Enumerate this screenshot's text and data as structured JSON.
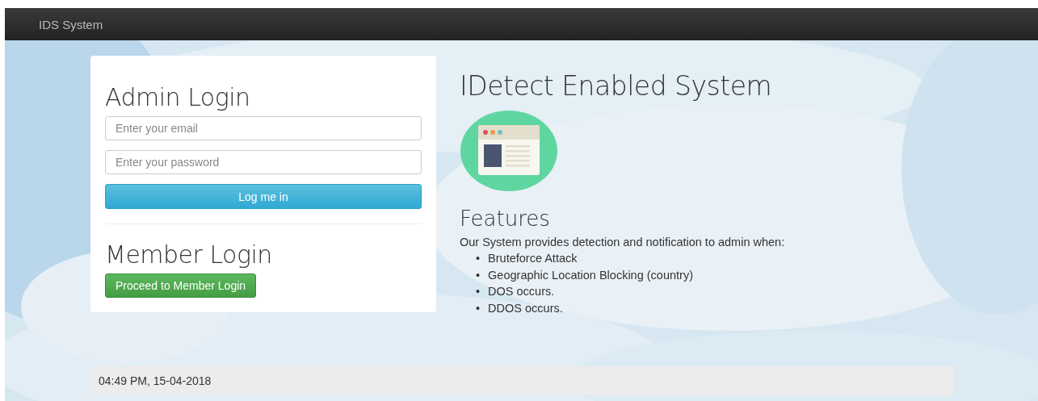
{
  "navbar": {
    "brand": "IDS System"
  },
  "admin_login": {
    "title": "Admin Login",
    "email": {
      "placeholder": "Enter your email"
    },
    "password": {
      "placeholder": "Enter your password"
    },
    "submit": "Log me in"
  },
  "member_login": {
    "title": "Member Login",
    "button": "Proceed to Member Login"
  },
  "info": {
    "title": "IDetect Enabled System",
    "features_title": "Features",
    "intro": "Our System provides detection and notification to admin when:",
    "features": [
      {
        "bullet": "•",
        "text": "Bruteforce Attack"
      },
      {
        "bullet": "•",
        "text": "Geographic Location Blocking (country)"
      },
      {
        "bullet": "•",
        "text": "DOS occurs."
      },
      {
        "bullet": "•",
        "text": "DDOS occurs."
      }
    ]
  },
  "footer": {
    "timestamp": "04:49 PM, 15-04-2018"
  }
}
